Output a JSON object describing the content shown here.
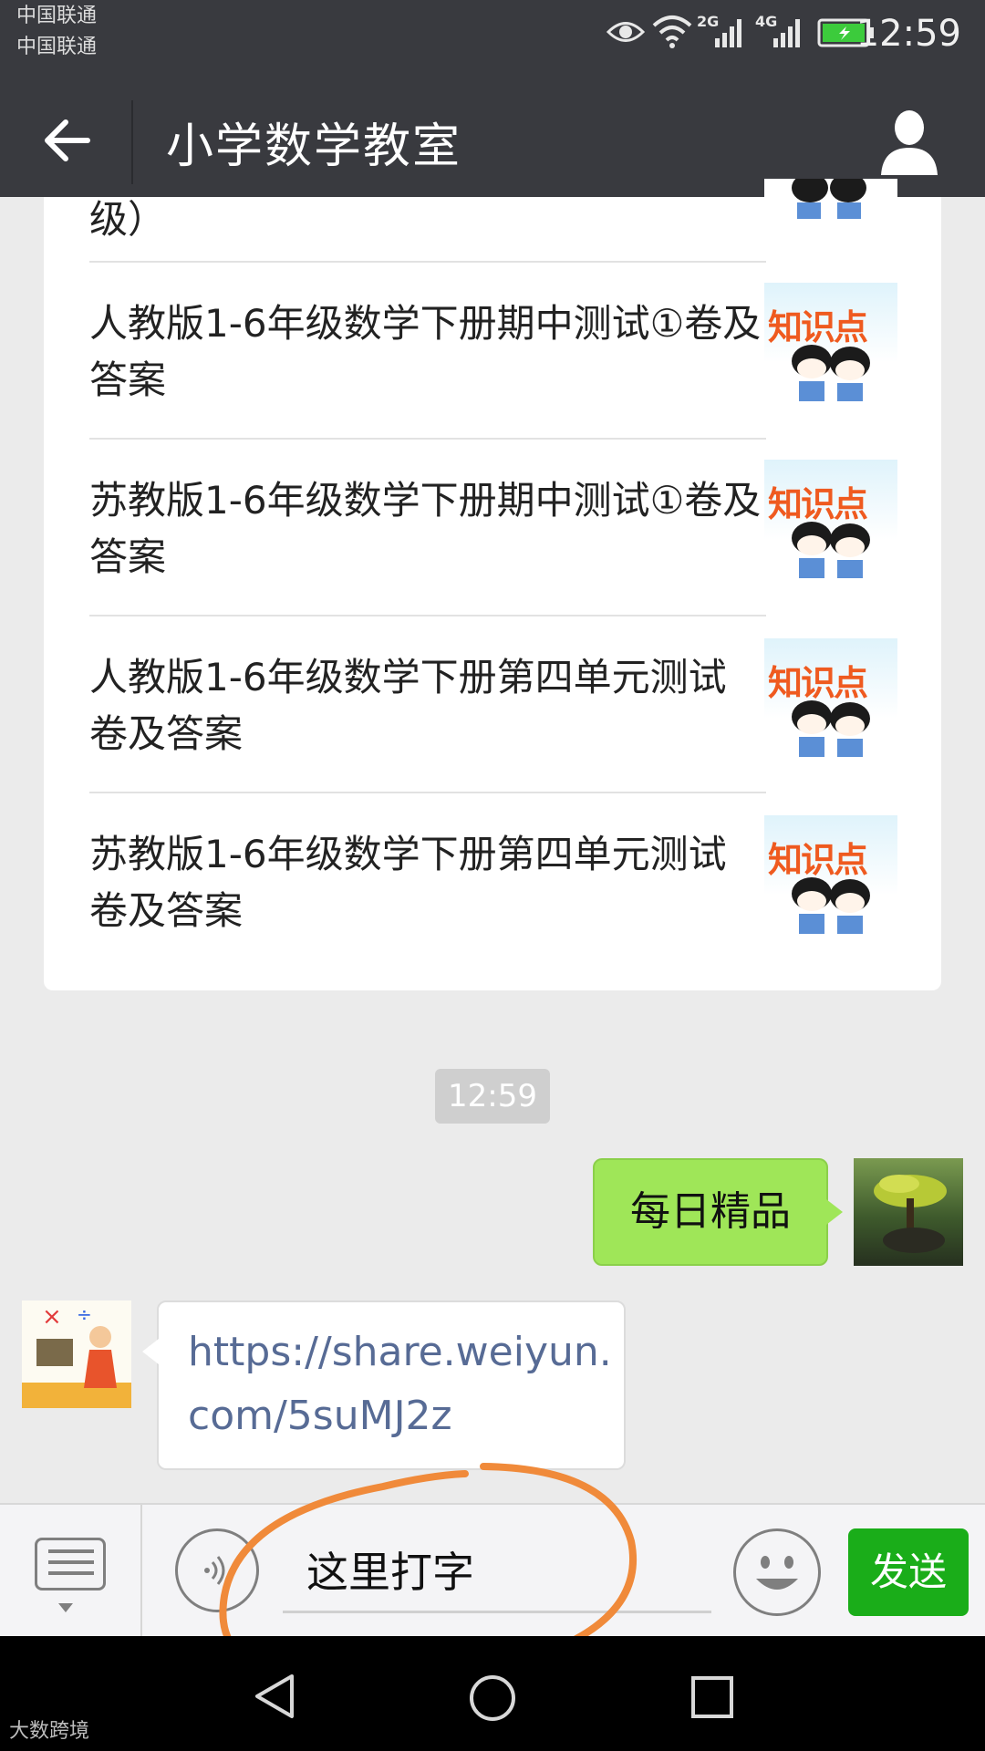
{
  "status_bar": {
    "carrier_1": "中国联通",
    "carrier_2": "中国联通",
    "network_1": "2G",
    "network_2": "4G",
    "time": "12:59",
    "icons": [
      "eye-icon",
      "wifi-icon",
      "signal-icon",
      "battery-charging-icon"
    ]
  },
  "nav": {
    "title": "小学数学教室",
    "back_icon": "arrow-left-icon",
    "profile_icon": "person-icon"
  },
  "article_card": {
    "partial_top_text": "级）",
    "items": [
      {
        "title": "人教版1-6年级数学下册期中测试①卷及答案",
        "thumb_text": "知识点"
      },
      {
        "title": "苏教版1-6年级数学下册期中测试①卷及答案",
        "thumb_text": "知识点"
      },
      {
        "title": "人教版1-6年级数学下册第四单元测试卷及答案",
        "thumb_text": "知识点"
      },
      {
        "title": "苏教版1-6年级数学下册第四单元测试卷及答案",
        "thumb_text": "知识点"
      }
    ]
  },
  "timestamp": "12:59",
  "messages": {
    "outgoing": "每日精品",
    "incoming": "https://share.weiyun.com/5suMJ2z"
  },
  "input_bar": {
    "text_value": "这里打字",
    "send_label": "发送",
    "icons": [
      "menu-list-icon",
      "voice-icon",
      "emoji-icon"
    ]
  },
  "watermark": "大数跨境",
  "colors": {
    "header": "#393a3f",
    "outgoing_bubble": "#9fe658",
    "link": "#576b95",
    "send_button": "#1aad19",
    "annotation_circle": "#f08a3a"
  }
}
